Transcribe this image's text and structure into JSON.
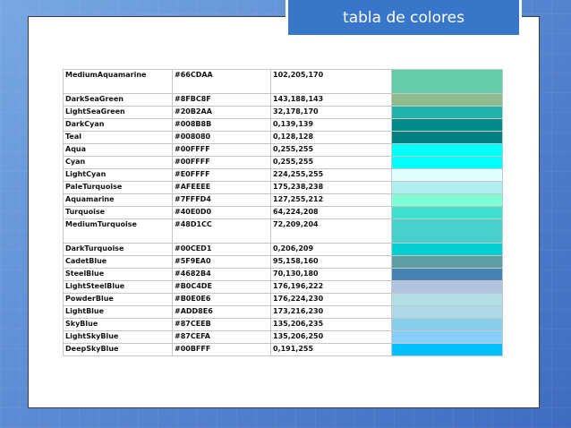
{
  "title": "tabla de colores",
  "rows": [
    {
      "name": "MediumAquamarine",
      "hex": "#66CDAA",
      "rgb": "102,205,170",
      "tall": true
    },
    {
      "name": "DarkSeaGreen",
      "hex": "#8FBC8F",
      "rgb": "143,188,143"
    },
    {
      "name": "LightSeaGreen",
      "hex": "#20B2AA",
      "rgb": "32,178,170"
    },
    {
      "name": "DarkCyan",
      "hex": "#008B8B",
      "rgb": "0,139,139"
    },
    {
      "name": "Teal",
      "hex": "#008080",
      "rgb": "0,128,128"
    },
    {
      "name": "Aqua",
      "hex": "#00FFFF",
      "rgb": "0,255,255"
    },
    {
      "name": "Cyan",
      "hex": "#00FFFF",
      "rgb": "0,255,255"
    },
    {
      "name": "LightCyan",
      "hex": "#E0FFFF",
      "rgb": "224,255,255"
    },
    {
      "name": "PaleTurquoise",
      "hex": "#AFEEEE",
      "rgb": "175,238,238"
    },
    {
      "name": "Aquamarine",
      "hex": "#7FFFD4",
      "rgb": "127,255,212"
    },
    {
      "name": "Turquoise",
      "hex": "#40E0D0",
      "rgb": "64,224,208"
    },
    {
      "name": "MediumTurquoise",
      "hex": "#48D1CC",
      "rgb": "72,209,204",
      "tall": true
    },
    {
      "name": "DarkTurquoise",
      "hex": "#00CED1",
      "rgb": "0,206,209"
    },
    {
      "name": "CadetBlue",
      "hex": "#5F9EA0",
      "rgb": "95,158,160"
    },
    {
      "name": "SteelBlue",
      "hex": "#4682B4",
      "rgb": "70,130,180"
    },
    {
      "name": "LightSteelBlue",
      "hex": "#B0C4DE",
      "rgb": "176,196,222"
    },
    {
      "name": "PowderBlue",
      "hex": "#B0E0E6",
      "rgb": "176,224,230"
    },
    {
      "name": "LightBlue",
      "hex": "#ADD8E6",
      "rgb": "173,216,230"
    },
    {
      "name": "SkyBlue",
      "hex": "#87CEEB",
      "rgb": "135,206,235"
    },
    {
      "name": "LightSkyBlue",
      "hex": "#87CEFA",
      "rgb": "135,206,250"
    },
    {
      "name": "DeepSkyBlue",
      "hex": "#00BFFF",
      "rgb": "0,191,255"
    }
  ]
}
